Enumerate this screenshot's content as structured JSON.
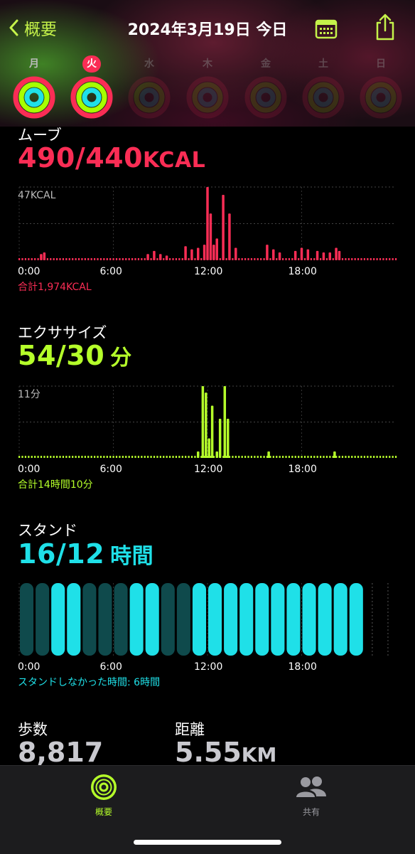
{
  "header": {
    "back_label": "概要",
    "date": "2024年3月19日 今日",
    "days": [
      {
        "label": "月",
        "state": "past",
        "rings": [
          1.0,
          1.0,
          1.0
        ]
      },
      {
        "label": "火",
        "state": "today",
        "rings": [
          1.0,
          1.0,
          1.0
        ]
      },
      {
        "label": "水",
        "state": "future",
        "rings": [
          0,
          0,
          0
        ]
      },
      {
        "label": "木",
        "state": "future",
        "rings": [
          0,
          0,
          0
        ]
      },
      {
        "label": "金",
        "state": "future",
        "rings": [
          0,
          0,
          0
        ]
      },
      {
        "label": "土",
        "state": "future",
        "rings": [
          0,
          0,
          0
        ]
      },
      {
        "label": "日",
        "state": "future",
        "rings": [
          0,
          0,
          0
        ]
      }
    ]
  },
  "move": {
    "title": "ムーブ",
    "value": "490/440",
    "unit": "KCAL",
    "max_label": "47KCAL",
    "total": "合計1,974KCAL",
    "color": "#fa2d55"
  },
  "exercise": {
    "title": "エクササイズ",
    "value": "54/30",
    "unit": "分",
    "max_label": "11分",
    "total": "合計14時間10分",
    "color": "#b5ff2a"
  },
  "stand": {
    "title": "スタンド",
    "value": "16/12",
    "unit": "時間",
    "total": "スタンドしなかった時間: 6時間",
    "color": "#1fe0e8"
  },
  "x_ticks": [
    "0:00",
    "6:00",
    "12:00",
    "18:00"
  ],
  "stats": {
    "steps_label": "歩数",
    "steps_value": "8,817",
    "distance_label": "距離",
    "distance_value": "5.55",
    "distance_unit": "KM"
  },
  "tabs": [
    {
      "label": "概要",
      "active": true
    },
    {
      "label": "共有",
      "active": false
    }
  ],
  "chart_data": [
    {
      "type": "bar",
      "title": "ムーブ",
      "x_unit": "hour",
      "ylabel": "KCAL",
      "ylim": [
        0,
        47
      ],
      "x": [
        12.0,
        12.2,
        12.4,
        12.6,
        13.0,
        13.4,
        13.8,
        10.6,
        11.0,
        11.4,
        11.8,
        9.0,
        9.4,
        8.2,
        8.6,
        15.8,
        16.2,
        16.6,
        17.6,
        18.0,
        18.4,
        19.0,
        19.4,
        19.8,
        20.2,
        20.4,
        1.4,
        1.6
      ],
      "values": [
        47,
        30,
        10,
        14,
        42,
        30,
        8,
        9,
        7,
        8,
        10,
        4,
        3,
        4,
        6,
        10,
        7,
        5,
        6,
        8,
        7,
        6,
        5,
        5,
        8,
        6,
        4,
        5
      ]
    },
    {
      "type": "bar",
      "title": "エクササイズ",
      "x_unit": "hour",
      "ylabel": "分",
      "ylim": [
        0,
        11
      ],
      "x": [
        11.4,
        11.7,
        11.9,
        12.1,
        12.3,
        12.6,
        12.8,
        13.1,
        13.3,
        15.9,
        20.1
      ],
      "values": [
        1,
        11,
        10,
        3,
        8,
        1,
        6,
        11,
        6,
        1,
        1
      ]
    },
    {
      "type": "bar",
      "title": "スタンド",
      "categories": [
        "0",
        "1",
        "2",
        "3",
        "4",
        "5",
        "6",
        "7",
        "8",
        "9",
        "10",
        "11",
        "12",
        "13",
        "14",
        "15",
        "16",
        "17",
        "18",
        "19",
        "20",
        "21",
        "22",
        "23"
      ],
      "values": [
        0,
        0,
        1,
        1,
        0,
        0,
        0,
        1,
        1,
        0,
        0,
        1,
        1,
        1,
        1,
        1,
        1,
        1,
        1,
        1,
        1,
        1,
        0,
        0
      ],
      "future_from_hour": 22
    }
  ]
}
